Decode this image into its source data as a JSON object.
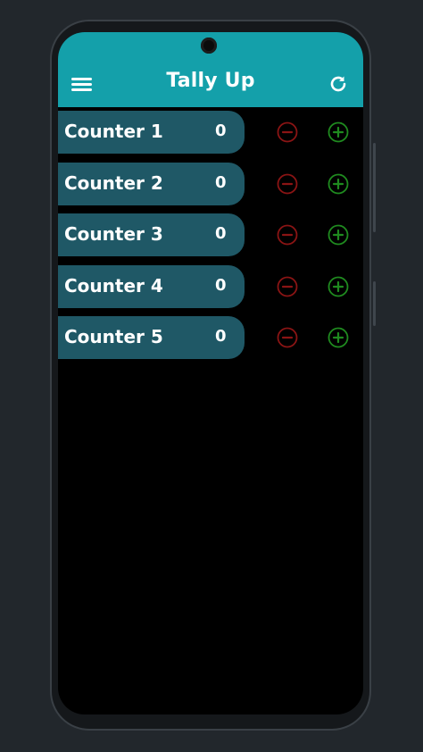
{
  "app": {
    "title": "Tally Up"
  },
  "counters": [
    {
      "label": "Counter 1",
      "count": "0"
    },
    {
      "label": "Counter 2",
      "count": "0"
    },
    {
      "label": "Counter 3",
      "count": "0"
    },
    {
      "label": "Counter 4",
      "count": "0"
    },
    {
      "label": "Counter 5",
      "count": "0"
    }
  ],
  "icons": {
    "menu": "hamburger-menu-icon",
    "refresh": "refresh-icon",
    "decrement": "minus-circle-icon",
    "increment": "plus-circle-icon"
  },
  "colors": {
    "appbar": "#14a0aa",
    "pill": "#1f5866",
    "decrement": "#8a1414",
    "increment": "#1f8a1f"
  }
}
